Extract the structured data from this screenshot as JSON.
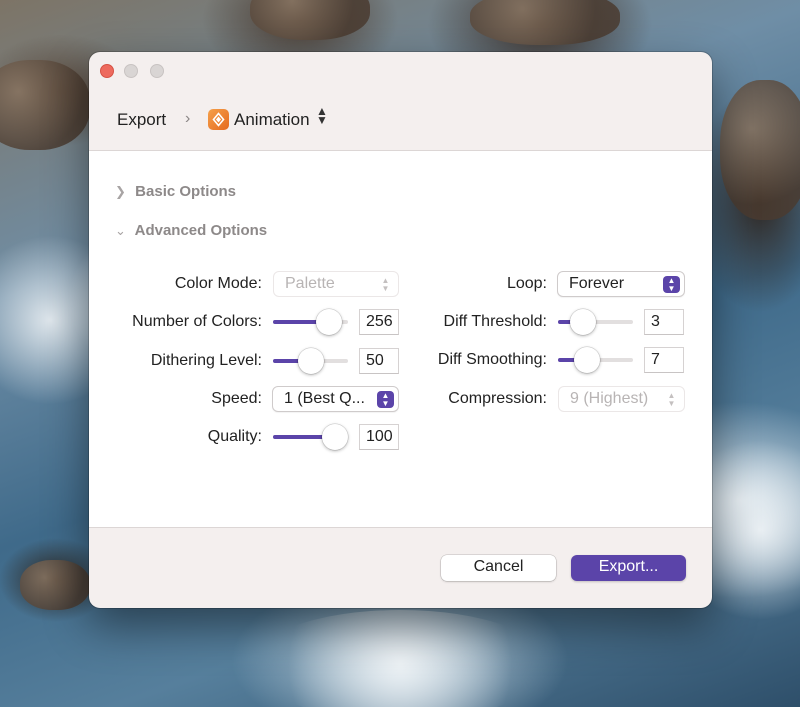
{
  "window": {
    "breadcrumb_root": "Export",
    "breadcrumb_separator": "›",
    "app_title": "Animation",
    "app_icon": "animation-app-icon"
  },
  "sections": {
    "basic": "Basic Options",
    "advanced": "Advanced Options"
  },
  "left_options": {
    "color_mode": {
      "label": "Color Mode:",
      "value": "Palette",
      "enabled": false
    },
    "number_of_colors": {
      "label": "Number of Colors:",
      "value": "256",
      "level": 0.75
    },
    "dithering_level": {
      "label": "Dithering Level:",
      "value": "50",
      "level": 0.5
    },
    "speed": {
      "label": "Speed:",
      "value": "1 (Best Q...",
      "enabled": true
    },
    "quality": {
      "label": "Quality:",
      "value": "100",
      "level": 0.82
    }
  },
  "right_options": {
    "loop": {
      "label": "Loop:",
      "value": "Forever",
      "enabled": true
    },
    "diff_threshold": {
      "label": "Diff Threshold:",
      "value": "3",
      "level": 0.33
    },
    "diff_smoothing": {
      "label": "Diff Smoothing:",
      "value": "7",
      "level": 0.38
    },
    "compression": {
      "label": "Compression:",
      "value": "9 (Highest)",
      "enabled": false
    }
  },
  "buttons": {
    "cancel": "Cancel",
    "export": "Export..."
  },
  "colors": {
    "accent": "#5b44a9",
    "close_button": "#ed6a5e",
    "window_bg": "#f4efee",
    "content_bg": "#ffffff"
  }
}
